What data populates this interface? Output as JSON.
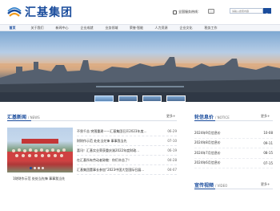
{
  "brand": {
    "name": "汇基集团"
  },
  "header": {
    "hotline_label": "全国服务热线：",
    "search_placeholder": "请输入搜索内容"
  },
  "nav": [
    "首页",
    "关于我们",
    "新闻中心",
    "企业成就",
    "业务领域",
    "荣誉·智能",
    "人力资源",
    "企业文化",
    "税务工作"
  ],
  "colors": {
    "brand": "#1a4c9c"
  },
  "news": {
    "title": "汇基新闻",
    "subtitle": "/ NEWS",
    "more": "更多+",
    "caption": "1财财作示范 处处当先锋 事事我当先",
    "items": [
      {
        "title": "不畏千苦 突围重建——汇基集团召开2023年度…",
        "date": "06-29"
      },
      {
        "title": "财财作示范 处处当先锋 事事我当先",
        "date": "07-10"
      },
      {
        "title": "喜讯！汇基实业荣获重庆渝2022年度财政…",
        "date": "06-19"
      },
      {
        "title": "在汇基所有劳动者致敬：你们辛苦了！",
        "date": "04-28"
      },
      {
        "title": "汇基集团董事长参加“2023中国大型国际召展…",
        "date": "04-07"
      }
    ]
  },
  "notice": {
    "title": "轮信息价",
    "subtitle": "/ NOTICE",
    "more": "更多+",
    "items": [
      {
        "title": "2024年9月信息价",
        "date": "10-08"
      },
      {
        "title": "2024年8月信息价",
        "date": "09-11"
      },
      {
        "title": "2024年7月信息价",
        "date": "08-15"
      },
      {
        "title": "2024年6月信息价",
        "date": "07-15"
      }
    ]
  },
  "video": {
    "title": "宣传视频",
    "subtitle": "/ VIDEO",
    "more": "更多+"
  }
}
